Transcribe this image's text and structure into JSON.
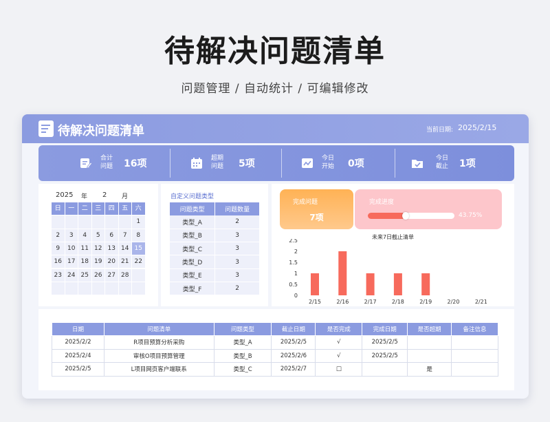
{
  "hero": {
    "title": "待解决问题清单",
    "subtitle": "问题管理 /  自动统计  /  可编辑修改"
  },
  "header": {
    "title": "待解决问题清单",
    "date_label": "当前日期:",
    "date_value": "2025/2/15"
  },
  "stats": [
    {
      "icon": "edit-note-icon",
      "label": "合计问题",
      "value": "16项"
    },
    {
      "icon": "calendar-icon",
      "label": "超期问题",
      "value": "5项"
    },
    {
      "icon": "trend-chart-icon",
      "label": "今日开始",
      "value": "0项"
    },
    {
      "icon": "folder-check-icon",
      "label": "今日截止",
      "value": "1项"
    }
  ],
  "calendar": {
    "year": "2025",
    "year_unit": "年",
    "month": "2",
    "month_unit": "月",
    "weekdays": [
      "日",
      "一",
      "二",
      "三",
      "四",
      "五",
      "六"
    ],
    "weeks": [
      [
        "",
        "",
        "",
        "",
        "",
        "",
        "1"
      ],
      [
        "2",
        "3",
        "4",
        "5",
        "6",
        "7",
        "8"
      ],
      [
        "9",
        "10",
        "11",
        "12",
        "13",
        "14",
        "15"
      ],
      [
        "16",
        "17",
        "18",
        "19",
        "20",
        "21",
        "22"
      ],
      [
        "23",
        "24",
        "25",
        "26",
        "27",
        "28",
        ""
      ],
      [
        "",
        "",
        "",
        "",
        "",
        "",
        ""
      ]
    ],
    "today": "15"
  },
  "types": {
    "title": "自定义问题类型",
    "headers": [
      "问题类型",
      "问题数量"
    ],
    "rows": [
      [
        "类型_A",
        "2"
      ],
      [
        "类型_B",
        "3"
      ],
      [
        "类型_C",
        "3"
      ],
      [
        "类型_D",
        "3"
      ],
      [
        "类型_E",
        "3"
      ],
      [
        "类型_F",
        "2"
      ]
    ]
  },
  "progress": {
    "done_label": "完成问题",
    "done_value": "7项",
    "progress_label": "完成进度",
    "progress_value": "43.75%",
    "progress_fraction": 0.4375
  },
  "chart_data": {
    "type": "bar",
    "title": "未来7日截止清单",
    "categories": [
      "2/15",
      "2/16",
      "2/17",
      "2/18",
      "2/19",
      "2/20",
      "2/21"
    ],
    "values": [
      1,
      2,
      1,
      1,
      1,
      0,
      0
    ],
    "ylim": [
      0,
      2.5
    ],
    "yticks": [
      "0",
      "0.5",
      "1",
      "1.5",
      "2",
      "2.5"
    ],
    "color": "#f76a5c",
    "grid": false
  },
  "issue_list": {
    "headers": [
      "日期",
      "问题清单",
      "问题类型",
      "截止日期",
      "是否完成",
      "完成日期",
      "是否超期",
      "备注信息"
    ],
    "rows": [
      [
        "2025/2/2",
        "R项目预算分析采购",
        "类型_A",
        "2025/2/5",
        "√",
        "2025/2/5",
        "",
        ""
      ],
      [
        "2025/2/4",
        "审核O项目预算管理",
        "类型_B",
        "2025/2/6",
        "√",
        "2025/2/5",
        "",
        ""
      ],
      [
        "2025/2/5",
        "L项目网页客户端联系",
        "类型_C",
        "2025/2/7",
        "□",
        "",
        "是",
        ""
      ]
    ]
  }
}
